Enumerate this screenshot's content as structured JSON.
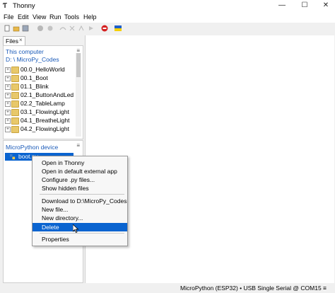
{
  "window": {
    "title": "Thonny",
    "icon": "thonny-icon"
  },
  "window_controls": {
    "minimize": "—",
    "maximize": "☐",
    "close": "✕"
  },
  "menu": [
    "File",
    "Edit",
    "View",
    "Run",
    "Tools",
    "Help"
  ],
  "toolbar_icons": [
    "new-file-icon",
    "open-file-icon",
    "save-icon",
    "run-icon",
    "debug-icon",
    "step-over-icon",
    "step-into-icon",
    "step-out-icon",
    "resume-icon",
    "stop-icon",
    "ukraine-flag-icon"
  ],
  "files_tab": {
    "label": "Files",
    "close": "×"
  },
  "this_computer": {
    "header": "This computer",
    "path": "D: \\ MicroPy_Codes",
    "items": [
      "00.0_HelloWorld",
      "00.1_Boot",
      "01.1_Blink",
      "02.1_ButtonAndLed",
      "02.2_TableLamp",
      "03.1_FlowingLight",
      "04.1_BreatheLight",
      "04.2_FlowingLight"
    ]
  },
  "micropython_device": {
    "header": "MicroPython device",
    "selected_item": "boot.py"
  },
  "context_menu": {
    "items": [
      "Open in Thonny",
      "Open in default external app",
      "Configure .py files...",
      "Show hidden files",
      "Download to D:\\MicroPy_Codes",
      "New file...",
      "New directory...",
      "Delete",
      "Properties"
    ],
    "highlighted": "Delete"
  },
  "status": {
    "text": "MicroPython (ESP32)  •  USB Single Serial @ COM15  ≡"
  },
  "colors": {
    "accent": "#0a64d0",
    "header_text": "#1a5ab8",
    "stop": "#d42020"
  }
}
